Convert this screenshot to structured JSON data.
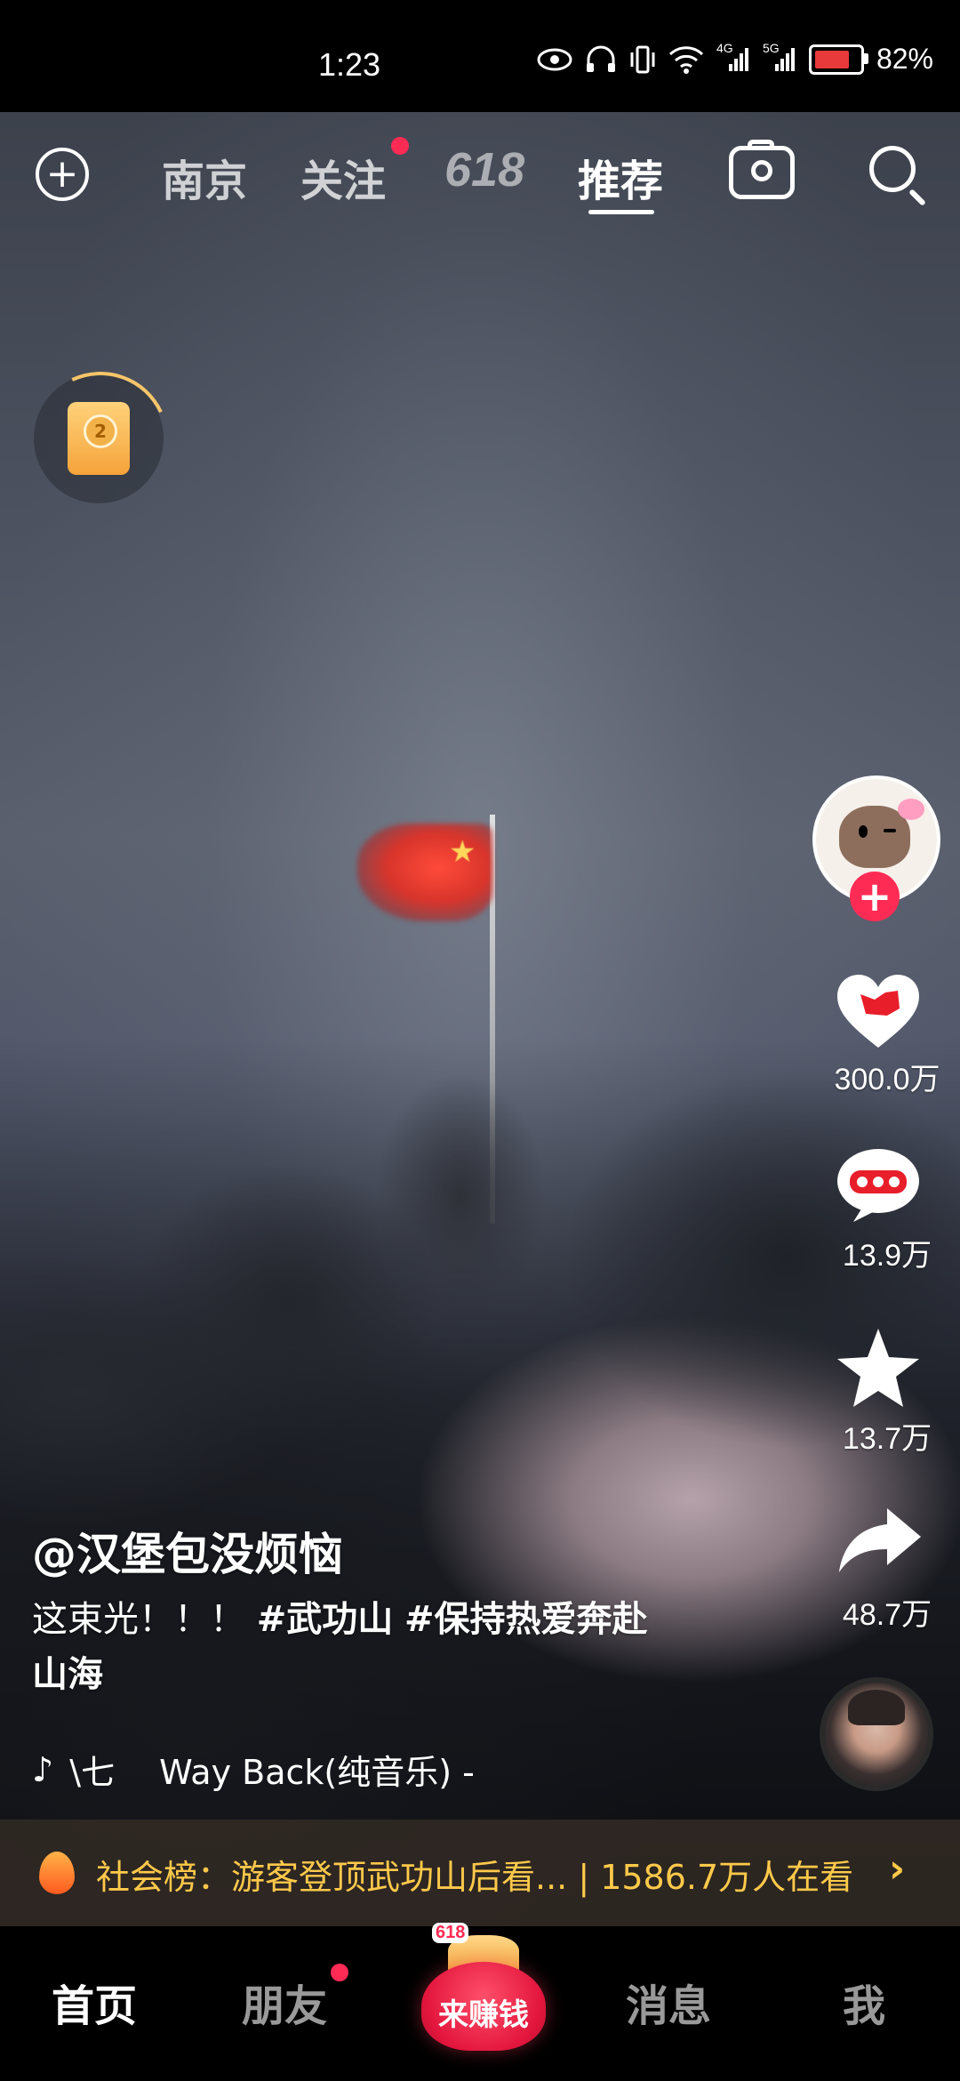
{
  "status_bar": {
    "time": "1:23",
    "network_4g": "4G",
    "network_5g": "5G",
    "battery": "82%"
  },
  "top_nav": {
    "tabs": [
      {
        "label": "南京"
      },
      {
        "label": "关注"
      },
      {
        "label": "618"
      },
      {
        "label": "推荐"
      }
    ],
    "active_tab": "推荐"
  },
  "reward": {
    "badge": "2"
  },
  "actions": {
    "likes": "300.0万",
    "comments": "13.9万",
    "favorites": "13.7万",
    "shares": "48.7万"
  },
  "caption": {
    "author": "@汉堡包没烦恼",
    "text": "这束光！！！",
    "tags": [
      "#武功山",
      "#保持热爱奔赴",
      "山海"
    ],
    "music": "\\七　 Way Back(纯音乐) -"
  },
  "hot": {
    "text": "社会榜：游客登顶武功山后看... | 1586.7万人在看"
  },
  "bottom_nav": {
    "items": [
      "首页",
      "朋友",
      "来赚钱",
      "消息",
      "我"
    ],
    "earn_badge": "618"
  }
}
